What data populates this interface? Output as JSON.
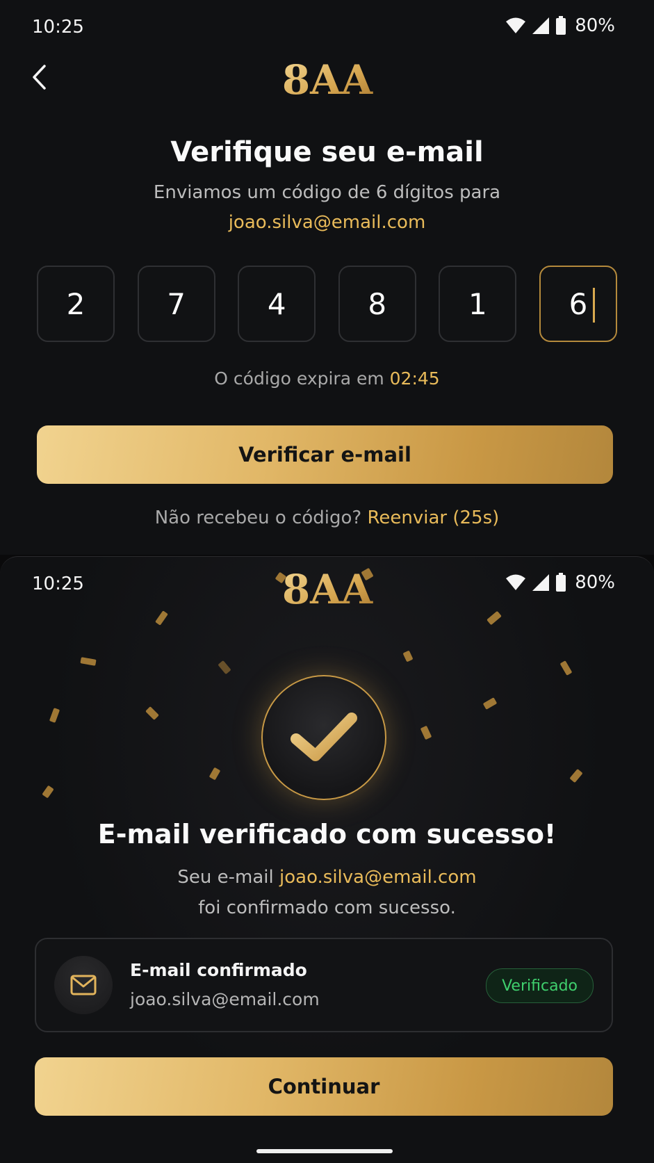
{
  "colors": {
    "accent": "#e9bb5a",
    "success": "#3fcf6d",
    "background": "#101113"
  },
  "screen1": {
    "status": {
      "time": "10:25",
      "battery": "80%"
    },
    "logo": "8AA",
    "title": "Verifique seu e-mail",
    "subtitle": "Enviamos um código de 6 dígitos para",
    "email": "joao.silva@email.com",
    "code_digits": [
      "2",
      "7",
      "4",
      "8",
      "1",
      "6"
    ],
    "expiry_prefix": "O código expira em",
    "expiry_time": "02:45",
    "verify_button": "Verificar e-mail",
    "resend_prompt": "Não recebeu o código?",
    "resend_link": "Reenviar (25s)"
  },
  "screen2": {
    "status": {
      "time": "10:25",
      "battery": "80%"
    },
    "logo": "8AA",
    "title": "E-mail verificado com sucesso!",
    "message_prefix": "Seu e-mail",
    "email": "joao.silva@email.com",
    "message_suffix": "foi confirmado com sucesso.",
    "card": {
      "title": "E-mail confirmado",
      "email": "joao.silva@email.com",
      "badge": "Verificado"
    },
    "continue_button": "Continuar"
  },
  "icons": [
    "back-arrow-icon",
    "wifi-icon",
    "signal-icon",
    "battery-icon",
    "checkmark-icon",
    "mail-icon"
  ]
}
